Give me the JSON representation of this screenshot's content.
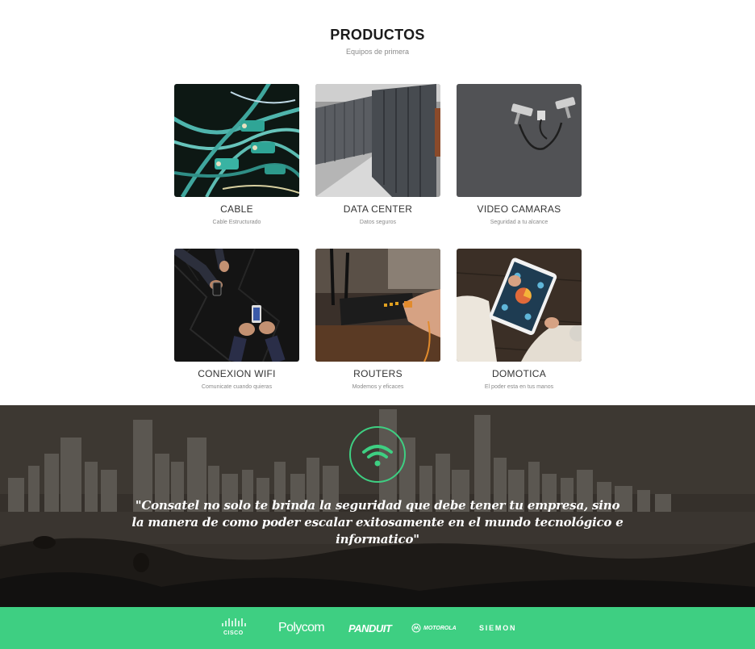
{
  "products": {
    "title": "PRODUCTOS",
    "subtitle": "Equipos de primera",
    "items": [
      {
        "name": "CABLE",
        "desc": "Cable Estructurado",
        "icon": "ethernet-cables-photo"
      },
      {
        "name": "DATA CENTER",
        "desc": "Datos seguros",
        "icon": "server-racks-photo"
      },
      {
        "name": "VIDEO CAMARAS",
        "desc": "Seguridad a tu alcance",
        "icon": "security-cameras-photo"
      },
      {
        "name": "CONEXION WIFI",
        "desc": "Comunicate cuando quieras",
        "icon": "phones-hands-photo"
      },
      {
        "name": "ROUTERS",
        "desc": "Modemos y eficaces",
        "icon": "router-photo"
      },
      {
        "name": "DOMOTICA",
        "desc": "El poder esta en tus manos",
        "icon": "tablet-photo"
      }
    ]
  },
  "banner": {
    "icon": "wifi-icon",
    "quote": "\"Consatel no solo te brinda la seguridad que debe tener tu empresa, sino la manera de como poder escalar exitosamente en el mundo tecnológico e informatico\""
  },
  "brands": {
    "items": [
      "CISCO",
      "Polycom",
      "PANDUIT",
      "MOTOROLA",
      "SIEMON"
    ]
  },
  "colors": {
    "accent": "#3ecf82"
  }
}
